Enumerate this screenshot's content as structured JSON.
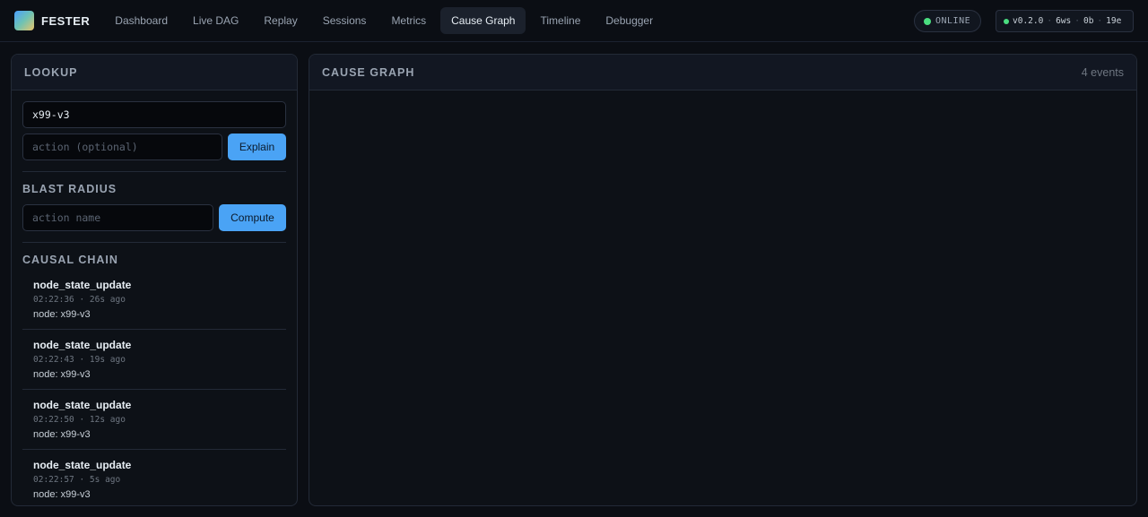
{
  "brand": {
    "name": "FESTER"
  },
  "nav": [
    {
      "label": "Dashboard",
      "active": false
    },
    {
      "label": "Live DAG",
      "active": false
    },
    {
      "label": "Replay",
      "active": false
    },
    {
      "label": "Sessions",
      "active": false
    },
    {
      "label": "Metrics",
      "active": false
    },
    {
      "label": "Cause Graph",
      "active": true
    },
    {
      "label": "Timeline",
      "active": false
    },
    {
      "label": "Debugger",
      "active": false
    }
  ],
  "status": {
    "label": "ONLINE",
    "color": "#4ade80"
  },
  "build": {
    "version": "v0.2.0",
    "ws": "6ws",
    "bytes": "0b",
    "events": "19e"
  },
  "lookup": {
    "title": "LOOKUP",
    "node_value": "x99-v3",
    "action_placeholder": "action (optional)",
    "explain_label": "Explain"
  },
  "blast": {
    "title": "BLAST RADIUS",
    "action_placeholder": "action name",
    "compute_label": "Compute"
  },
  "chain": {
    "title": "CAUSAL CHAIN",
    "items": [
      {
        "name": "node_state_update",
        "time": "02:22:36 · 26s ago",
        "node": "node: x99-v3"
      },
      {
        "name": "node_state_update",
        "time": "02:22:43 · 19s ago",
        "node": "node: x99-v3"
      },
      {
        "name": "node_state_update",
        "time": "02:22:50 · 12s ago",
        "node": "node: x99-v3"
      },
      {
        "name": "node_state_update",
        "time": "02:22:57 · 5s ago",
        "node": "node: x99-v3"
      }
    ]
  },
  "graph": {
    "title": "CAUSE GRAPH",
    "count": "4 events"
  },
  "colors": {
    "accent": "#4aa3f5",
    "online": "#4ade80",
    "background": "#0b0e14"
  }
}
